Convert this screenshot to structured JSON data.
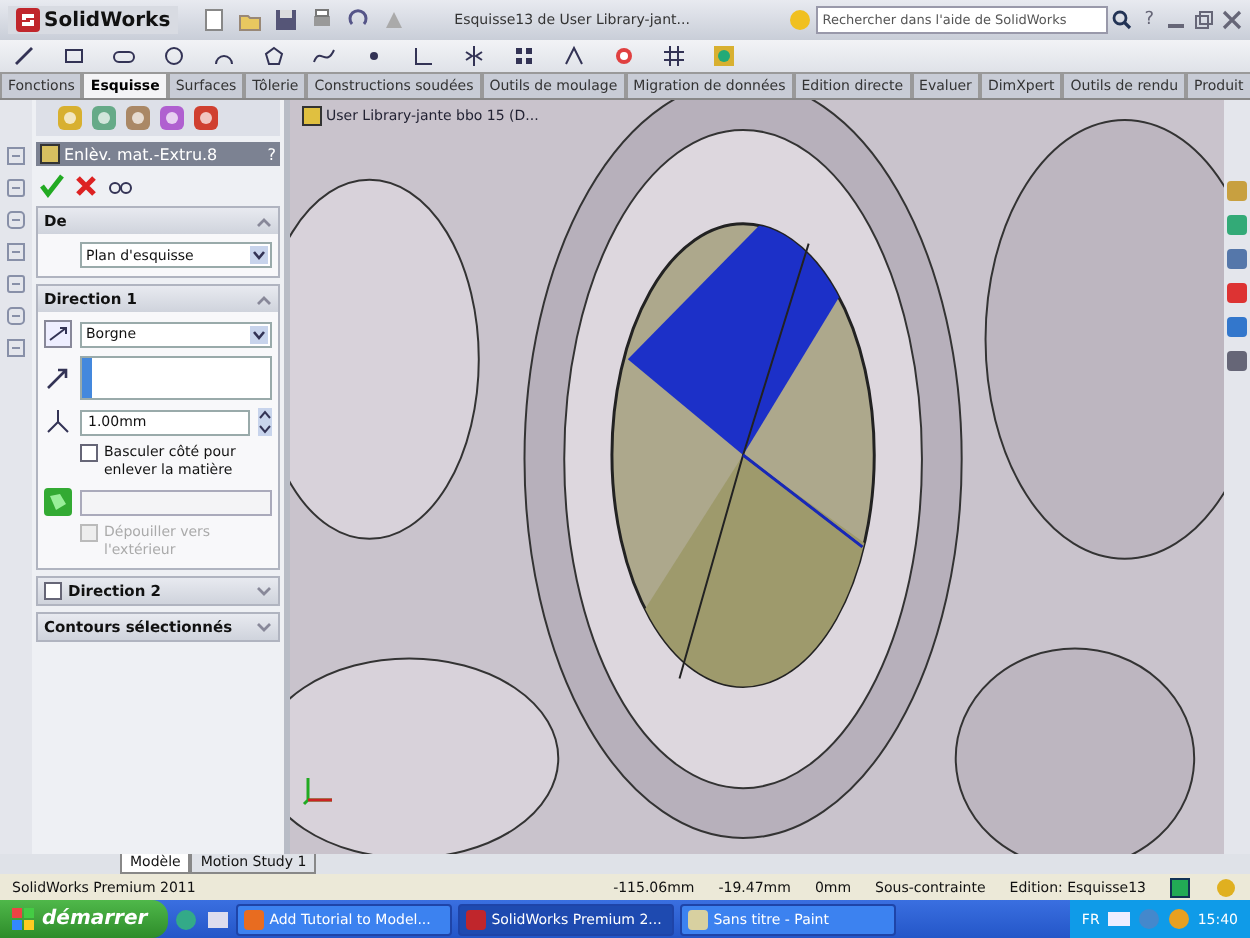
{
  "window": {
    "app": "SolidWorks",
    "title": "Esquisse13 de User Library-jant...",
    "search": {
      "placeholder": "Rechercher dans l'aide de SolidWorks"
    },
    "help": "?"
  },
  "tabs": [
    {
      "label": "Fonctions",
      "selected": false
    },
    {
      "label": "Esquisse",
      "selected": true
    },
    {
      "label": "Surfaces",
      "selected": false
    },
    {
      "label": "Tôlerie",
      "selected": false
    },
    {
      "label": "Constructions soudées",
      "selected": false
    },
    {
      "label": "Outils de moulage",
      "selected": false
    },
    {
      "label": "Migration de données",
      "selected": false
    },
    {
      "label": "Edition directe",
      "selected": false
    },
    {
      "label": "Evaluer",
      "selected": false
    },
    {
      "label": "DimXpert",
      "selected": false
    },
    {
      "label": "Outils de rendu",
      "selected": false
    },
    {
      "label": "Produit",
      "selected": false
    }
  ],
  "property_manager": {
    "title": "Enlèv. mat.-Extru.8",
    "help": "?",
    "sections": [
      {
        "kind": "from",
        "title": "De",
        "expanded": true,
        "value": "Plan d'esquisse"
      },
      {
        "kind": "direction",
        "title": "Direction 1",
        "expanded": true,
        "end_condition": "Borgne",
        "depth": "1.00mm",
        "flip": {
          "label": "Basculer côté pour enlever la matière",
          "checked": false
        },
        "draft": {
          "label": "Dépouiller vers l'extérieur",
          "disabled": true
        }
      },
      {
        "kind": "optional",
        "title": "Direction 2",
        "expanded": false,
        "checked": false
      },
      {
        "kind": "plain",
        "title": "Contours sélectionnés",
        "expanded": false
      }
    ]
  },
  "viewport": {
    "tree_label": "User Library-jante bbo 15 (D..."
  },
  "model_tabs": [
    {
      "label": "Modèle",
      "selected": true
    },
    {
      "label": "Motion Study 1",
      "selected": false
    }
  ],
  "status_bar": {
    "product": "SolidWorks Premium 2011",
    "x": "-115.06mm",
    "y": "-19.47mm",
    "z": "0mm",
    "state": "Sous-contrainte",
    "editing": "Edition: Esquisse13"
  },
  "taskbar": {
    "start": "démarrer",
    "windows": [
      {
        "label": "Add Tutorial to Model...",
        "selected": false
      },
      {
        "label": "SolidWorks Premium 2...",
        "selected": true
      },
      {
        "label": "Sans titre - Paint",
        "selected": false
      }
    ],
    "language": "FR",
    "clock": "15:40"
  }
}
